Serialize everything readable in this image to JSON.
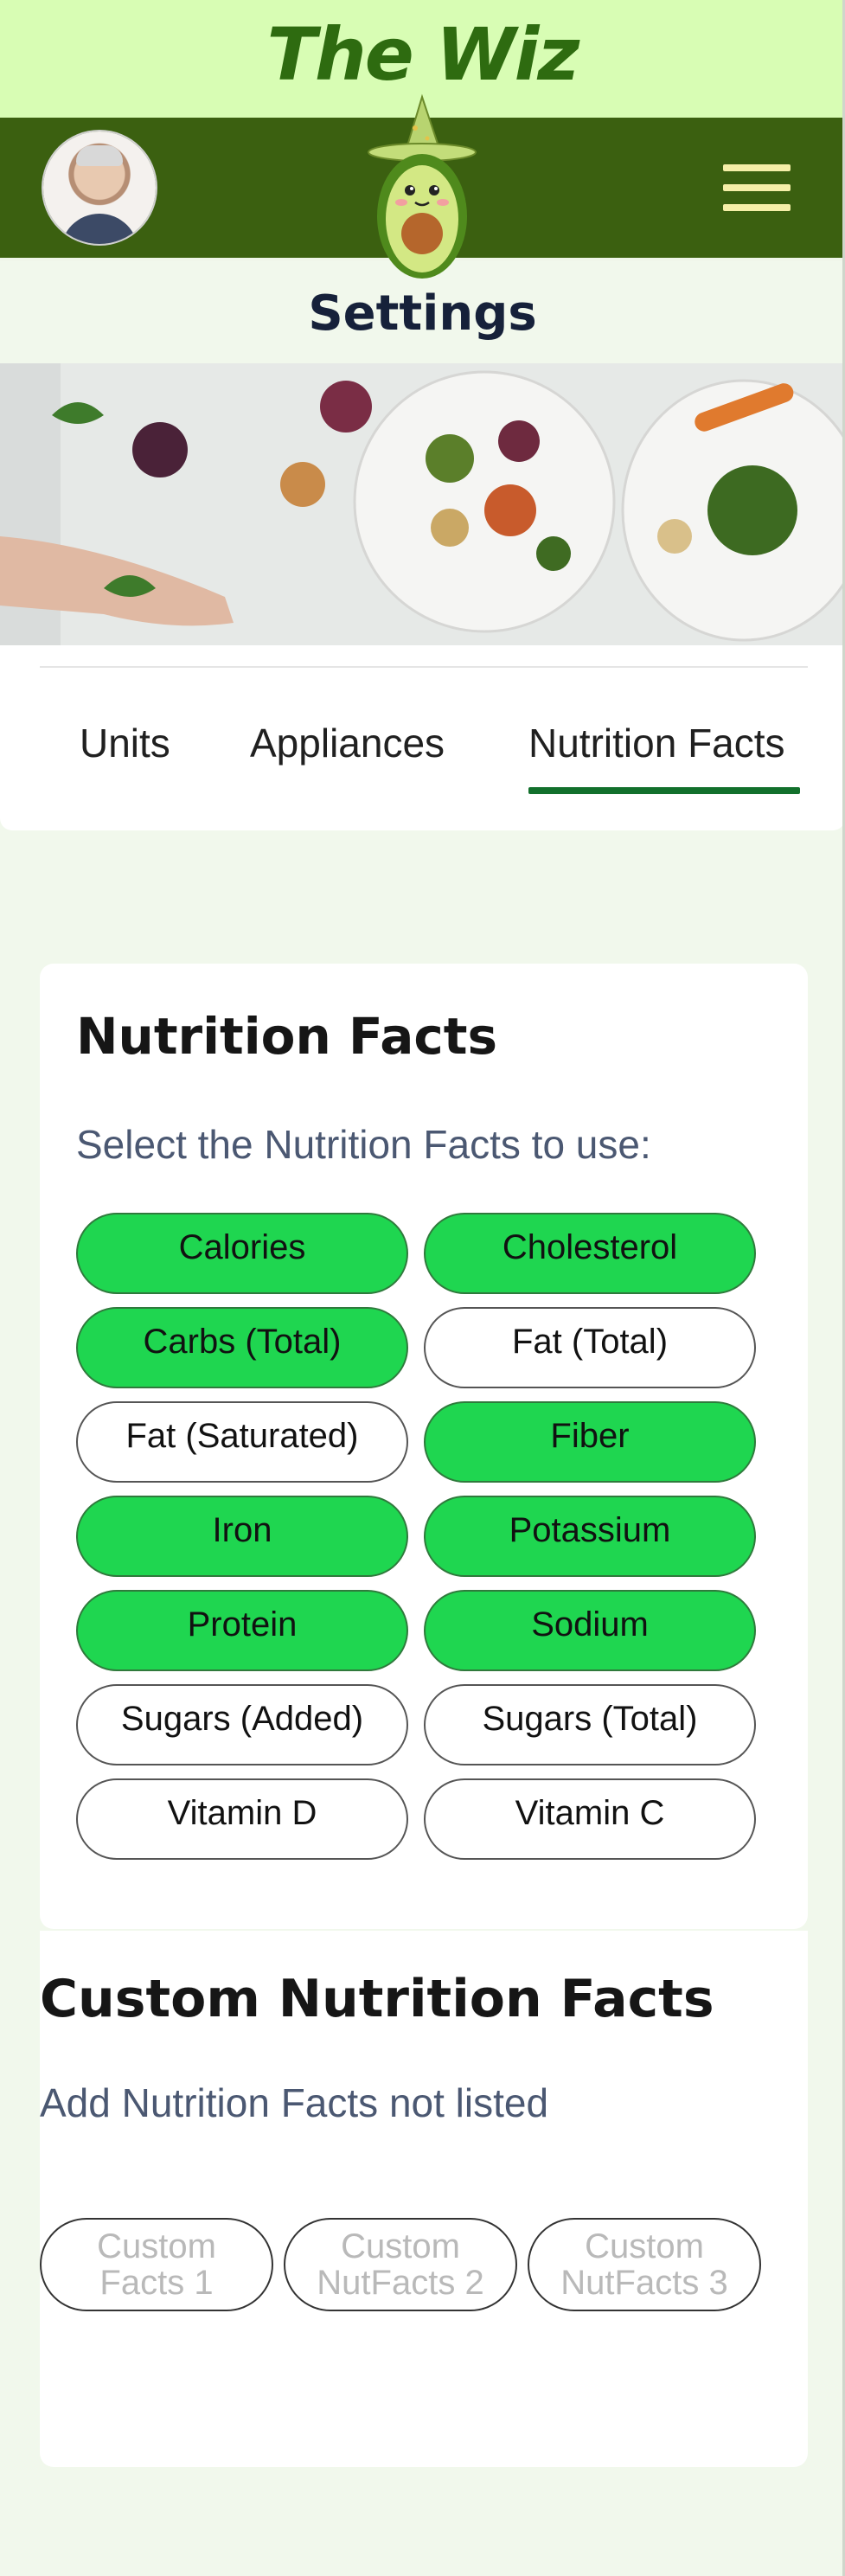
{
  "app": {
    "title": "The Wiz"
  },
  "page": {
    "title": "Settings"
  },
  "tabs": [
    {
      "label": "Units",
      "active": false
    },
    {
      "label": "Appliances",
      "active": false
    },
    {
      "label": "Nutrition Facts",
      "active": true
    }
  ],
  "nutrition": {
    "title": "Nutrition Facts",
    "subtitle": "Select the Nutrition Facts to use:",
    "options": [
      {
        "label": "Calories",
        "selected": true
      },
      {
        "label": "Cholesterol",
        "selected": true
      },
      {
        "label": "Carbs (Total)",
        "selected": true
      },
      {
        "label": "Fat (Total)",
        "selected": false
      },
      {
        "label": "Fat (Saturated)",
        "selected": false
      },
      {
        "label": "Fiber",
        "selected": true
      },
      {
        "label": "Iron",
        "selected": true
      },
      {
        "label": "Potassium",
        "selected": true
      },
      {
        "label": "Protein",
        "selected": true
      },
      {
        "label": "Sodium",
        "selected": true
      },
      {
        "label": "Sugars (Added)",
        "selected": false
      },
      {
        "label": "Sugars (Total)",
        "selected": false
      },
      {
        "label": "Vitamin D",
        "selected": false
      },
      {
        "label": "Vitamin C",
        "selected": false
      }
    ]
  },
  "custom": {
    "title": "Custom Nutrition Facts",
    "subtitle": "Add Nutrition Facts not listed",
    "buttons": [
      {
        "line1": "Custom",
        "line2": "Facts 1"
      },
      {
        "line1": "Custom",
        "line2": "NutFacts 2"
      },
      {
        "line1": "Custom",
        "line2": "NutFacts 3"
      }
    ]
  },
  "icons": {
    "menu": "hamburger-menu-icon",
    "avatar": "user-avatar",
    "mascot": "avocado-wizard-mascot"
  },
  "colors": {
    "topbar": "#d8fdb4",
    "navbar": "#3b6010",
    "selected_chip": "#1fd650",
    "tab_underline": "#12702c",
    "subtitle": "#4b5872"
  }
}
